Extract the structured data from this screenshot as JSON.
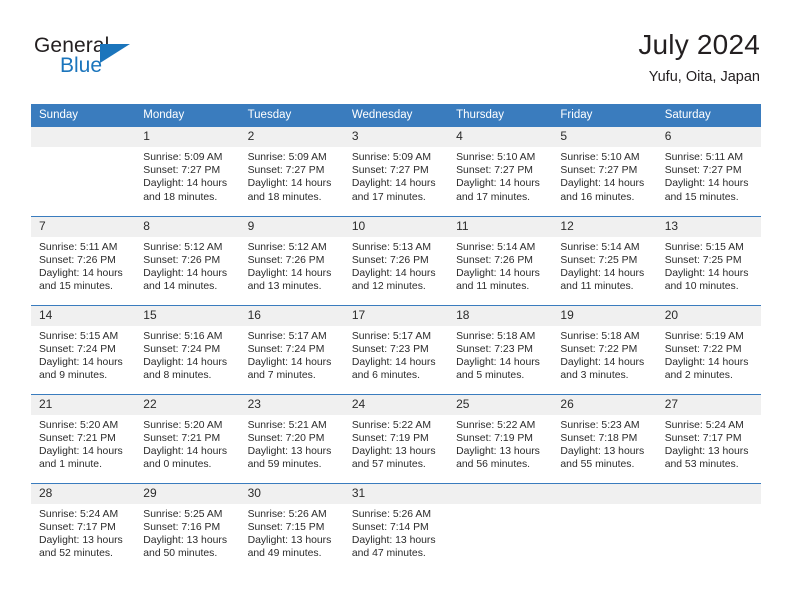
{
  "brand": {
    "name_part1": "General",
    "name_part2": "Blue",
    "flag_icon": "triangle-flag-icon"
  },
  "header": {
    "title": "July 2024",
    "location": "Yufu, Oita, Japan"
  },
  "colors": {
    "header_blue": "#3a7cbe",
    "brand_blue": "#1b75bc",
    "daynum_band": "#f0f0f0",
    "text": "#2b2b2b"
  },
  "weekdays": [
    "Sunday",
    "Monday",
    "Tuesday",
    "Wednesday",
    "Thursday",
    "Friday",
    "Saturday"
  ],
  "labels": {
    "sunrise": "Sunrise:",
    "sunset": "Sunset:",
    "daylight": "Daylight:"
  },
  "weeks": [
    [
      {
        "day": "",
        "sunrise": "",
        "sunset": "",
        "daylight1": "",
        "daylight2": ""
      },
      {
        "day": "1",
        "sunrise": "Sunrise: 5:09 AM",
        "sunset": "Sunset: 7:27 PM",
        "daylight1": "Daylight: 14 hours",
        "daylight2": "and 18 minutes."
      },
      {
        "day": "2",
        "sunrise": "Sunrise: 5:09 AM",
        "sunset": "Sunset: 7:27 PM",
        "daylight1": "Daylight: 14 hours",
        "daylight2": "and 18 minutes."
      },
      {
        "day": "3",
        "sunrise": "Sunrise: 5:09 AM",
        "sunset": "Sunset: 7:27 PM",
        "daylight1": "Daylight: 14 hours",
        "daylight2": "and 17 minutes."
      },
      {
        "day": "4",
        "sunrise": "Sunrise: 5:10 AM",
        "sunset": "Sunset: 7:27 PM",
        "daylight1": "Daylight: 14 hours",
        "daylight2": "and 17 minutes."
      },
      {
        "day": "5",
        "sunrise": "Sunrise: 5:10 AM",
        "sunset": "Sunset: 7:27 PM",
        "daylight1": "Daylight: 14 hours",
        "daylight2": "and 16 minutes."
      },
      {
        "day": "6",
        "sunrise": "Sunrise: 5:11 AM",
        "sunset": "Sunset: 7:27 PM",
        "daylight1": "Daylight: 14 hours",
        "daylight2": "and 15 minutes."
      }
    ],
    [
      {
        "day": "7",
        "sunrise": "Sunrise: 5:11 AM",
        "sunset": "Sunset: 7:26 PM",
        "daylight1": "Daylight: 14 hours",
        "daylight2": "and 15 minutes."
      },
      {
        "day": "8",
        "sunrise": "Sunrise: 5:12 AM",
        "sunset": "Sunset: 7:26 PM",
        "daylight1": "Daylight: 14 hours",
        "daylight2": "and 14 minutes."
      },
      {
        "day": "9",
        "sunrise": "Sunrise: 5:12 AM",
        "sunset": "Sunset: 7:26 PM",
        "daylight1": "Daylight: 14 hours",
        "daylight2": "and 13 minutes."
      },
      {
        "day": "10",
        "sunrise": "Sunrise: 5:13 AM",
        "sunset": "Sunset: 7:26 PM",
        "daylight1": "Daylight: 14 hours",
        "daylight2": "and 12 minutes."
      },
      {
        "day": "11",
        "sunrise": "Sunrise: 5:14 AM",
        "sunset": "Sunset: 7:26 PM",
        "daylight1": "Daylight: 14 hours",
        "daylight2": "and 11 minutes."
      },
      {
        "day": "12",
        "sunrise": "Sunrise: 5:14 AM",
        "sunset": "Sunset: 7:25 PM",
        "daylight1": "Daylight: 14 hours",
        "daylight2": "and 11 minutes."
      },
      {
        "day": "13",
        "sunrise": "Sunrise: 5:15 AM",
        "sunset": "Sunset: 7:25 PM",
        "daylight1": "Daylight: 14 hours",
        "daylight2": "and 10 minutes."
      }
    ],
    [
      {
        "day": "14",
        "sunrise": "Sunrise: 5:15 AM",
        "sunset": "Sunset: 7:24 PM",
        "daylight1": "Daylight: 14 hours",
        "daylight2": "and 9 minutes."
      },
      {
        "day": "15",
        "sunrise": "Sunrise: 5:16 AM",
        "sunset": "Sunset: 7:24 PM",
        "daylight1": "Daylight: 14 hours",
        "daylight2": "and 8 minutes."
      },
      {
        "day": "16",
        "sunrise": "Sunrise: 5:17 AM",
        "sunset": "Sunset: 7:24 PM",
        "daylight1": "Daylight: 14 hours",
        "daylight2": "and 7 minutes."
      },
      {
        "day": "17",
        "sunrise": "Sunrise: 5:17 AM",
        "sunset": "Sunset: 7:23 PM",
        "daylight1": "Daylight: 14 hours",
        "daylight2": "and 6 minutes."
      },
      {
        "day": "18",
        "sunrise": "Sunrise: 5:18 AM",
        "sunset": "Sunset: 7:23 PM",
        "daylight1": "Daylight: 14 hours",
        "daylight2": "and 5 minutes."
      },
      {
        "day": "19",
        "sunrise": "Sunrise: 5:18 AM",
        "sunset": "Sunset: 7:22 PM",
        "daylight1": "Daylight: 14 hours",
        "daylight2": "and 3 minutes."
      },
      {
        "day": "20",
        "sunrise": "Sunrise: 5:19 AM",
        "sunset": "Sunset: 7:22 PM",
        "daylight1": "Daylight: 14 hours",
        "daylight2": "and 2 minutes."
      }
    ],
    [
      {
        "day": "21",
        "sunrise": "Sunrise: 5:20 AM",
        "sunset": "Sunset: 7:21 PM",
        "daylight1": "Daylight: 14 hours",
        "daylight2": "and 1 minute."
      },
      {
        "day": "22",
        "sunrise": "Sunrise: 5:20 AM",
        "sunset": "Sunset: 7:21 PM",
        "daylight1": "Daylight: 14 hours",
        "daylight2": "and 0 minutes."
      },
      {
        "day": "23",
        "sunrise": "Sunrise: 5:21 AM",
        "sunset": "Sunset: 7:20 PM",
        "daylight1": "Daylight: 13 hours",
        "daylight2": "and 59 minutes."
      },
      {
        "day": "24",
        "sunrise": "Sunrise: 5:22 AM",
        "sunset": "Sunset: 7:19 PM",
        "daylight1": "Daylight: 13 hours",
        "daylight2": "and 57 minutes."
      },
      {
        "day": "25",
        "sunrise": "Sunrise: 5:22 AM",
        "sunset": "Sunset: 7:19 PM",
        "daylight1": "Daylight: 13 hours",
        "daylight2": "and 56 minutes."
      },
      {
        "day": "26",
        "sunrise": "Sunrise: 5:23 AM",
        "sunset": "Sunset: 7:18 PM",
        "daylight1": "Daylight: 13 hours",
        "daylight2": "and 55 minutes."
      },
      {
        "day": "27",
        "sunrise": "Sunrise: 5:24 AM",
        "sunset": "Sunset: 7:17 PM",
        "daylight1": "Daylight: 13 hours",
        "daylight2": "and 53 minutes."
      }
    ],
    [
      {
        "day": "28",
        "sunrise": "Sunrise: 5:24 AM",
        "sunset": "Sunset: 7:17 PM",
        "daylight1": "Daylight: 13 hours",
        "daylight2": "and 52 minutes."
      },
      {
        "day": "29",
        "sunrise": "Sunrise: 5:25 AM",
        "sunset": "Sunset: 7:16 PM",
        "daylight1": "Daylight: 13 hours",
        "daylight2": "and 50 minutes."
      },
      {
        "day": "30",
        "sunrise": "Sunrise: 5:26 AM",
        "sunset": "Sunset: 7:15 PM",
        "daylight1": "Daylight: 13 hours",
        "daylight2": "and 49 minutes."
      },
      {
        "day": "31",
        "sunrise": "Sunrise: 5:26 AM",
        "sunset": "Sunset: 7:14 PM",
        "daylight1": "Daylight: 13 hours",
        "daylight2": "and 47 minutes."
      },
      {
        "day": "",
        "sunrise": "",
        "sunset": "",
        "daylight1": "",
        "daylight2": ""
      },
      {
        "day": "",
        "sunrise": "",
        "sunset": "",
        "daylight1": "",
        "daylight2": ""
      },
      {
        "day": "",
        "sunrise": "",
        "sunset": "",
        "daylight1": "",
        "daylight2": ""
      }
    ]
  ]
}
